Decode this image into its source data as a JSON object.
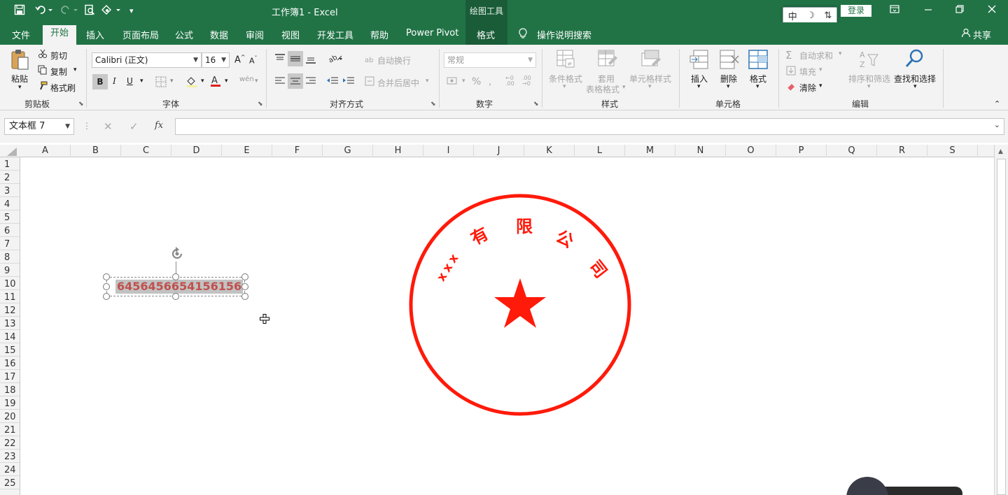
{
  "title_bar": {
    "doc_title": "工作簿1  -  Excel",
    "context_label": "绘图工具",
    "login": "登录",
    "ime": [
      "中",
      "☽",
      "⇅"
    ]
  },
  "tabs": [
    "文件",
    "开始",
    "插入",
    "页面布局",
    "公式",
    "数据",
    "审阅",
    "视图",
    "开发工具",
    "帮助",
    "Power Pivot",
    "格式"
  ],
  "tell_me": "操作说明搜索",
  "share": "共享",
  "ribbon": {
    "clipboard": {
      "paste": "粘贴",
      "cut": "剪切",
      "copy": "复制",
      "format_painter": "格式刷",
      "label": "剪贴板"
    },
    "font": {
      "name": "Calibri (正文)",
      "size": "16",
      "bold": "B",
      "italic": "I",
      "underline": "U",
      "label": "字体"
    },
    "alignment": {
      "wrap": "自动换行",
      "merge": "合并后居中",
      "label": "对齐方式"
    },
    "number": {
      "format": "常规",
      "percent": "%",
      "label": "数字"
    },
    "styles": {
      "conditional": "条件格式",
      "table_a": "套用",
      "table_b": "表格格式",
      "cell_styles": "单元格样式",
      "label": "样式"
    },
    "cells": {
      "insert": "插入",
      "delete": "删除",
      "format": "格式",
      "label": "单元格"
    },
    "editing": {
      "autosum": "自动求和",
      "fill": "填充",
      "clear": "清除",
      "sort": "排序和筛选",
      "find": "查找和选择",
      "label": "编辑"
    }
  },
  "formula_bar": {
    "name_box": "文本框 7",
    "fx": "fx",
    "formula": ""
  },
  "columns": [
    "A",
    "B",
    "C",
    "D",
    "E",
    "F",
    "G",
    "H",
    "I",
    "J",
    "K",
    "L",
    "M",
    "N",
    "O",
    "P",
    "Q",
    "R",
    "S"
  ],
  "rows": [
    "1",
    "2",
    "3",
    "4",
    "5",
    "6",
    "7",
    "8",
    "9",
    "10",
    "11",
    "12",
    "13",
    "14",
    "15",
    "16",
    "17",
    "18",
    "19",
    "20",
    "21",
    "22",
    "23",
    "24",
    "25"
  ],
  "textbox": {
    "text": "6456456654156156"
  },
  "seal": {
    "chars": [
      "x",
      "x",
      "x",
      "有",
      "限",
      "公",
      "司"
    ],
    "color": "#ff0000"
  },
  "colors": {
    "accent": "#217346",
    "seal": "#ff1a0a",
    "textbox_text": "#c0504d"
  }
}
